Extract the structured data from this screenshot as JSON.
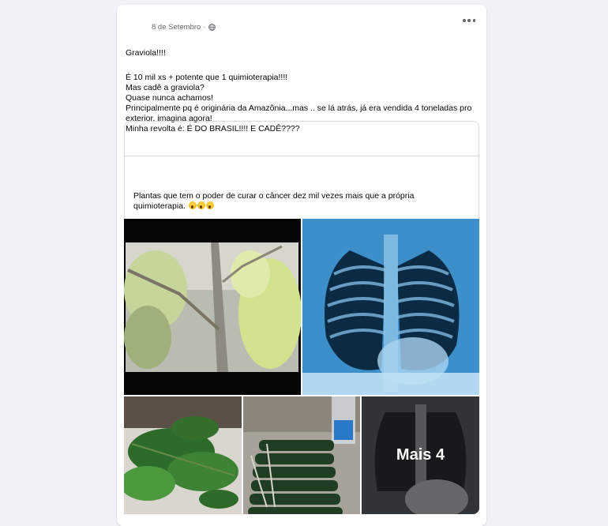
{
  "post": {
    "date": "8 de Setembro",
    "dot": "·",
    "lines": [
      "Graviola!!!!",
      "É 10 mil xs + potente que 1 quimioterapia!!!!\nMas cadê a graviola?\nQuase nunca achamos!\nPrincipalmente pq é originária da Amazônia...mas .. se lá atrás, já era vendida 4 toneladas pro exterior, imagina agora!\nMinha revolta é: É DO BRASIL!!!! E CADÊ????"
    ]
  },
  "shared": {
    "text": "Plantas que tem o poder de curar o câncer dez mil  vezes mais que a própria quimioterapia."
  },
  "photos": {
    "more_label": "Mais 4",
    "icons": [
      "video-still-branch",
      "chest-xray",
      "leaves",
      "wrapped-leaves",
      "chest-xray-dark"
    ]
  },
  "colors": {
    "background": "#f0f2f5",
    "card": "#ffffff",
    "secondary_text": "#65676b",
    "xray_blue": "#3d8fc9"
  }
}
